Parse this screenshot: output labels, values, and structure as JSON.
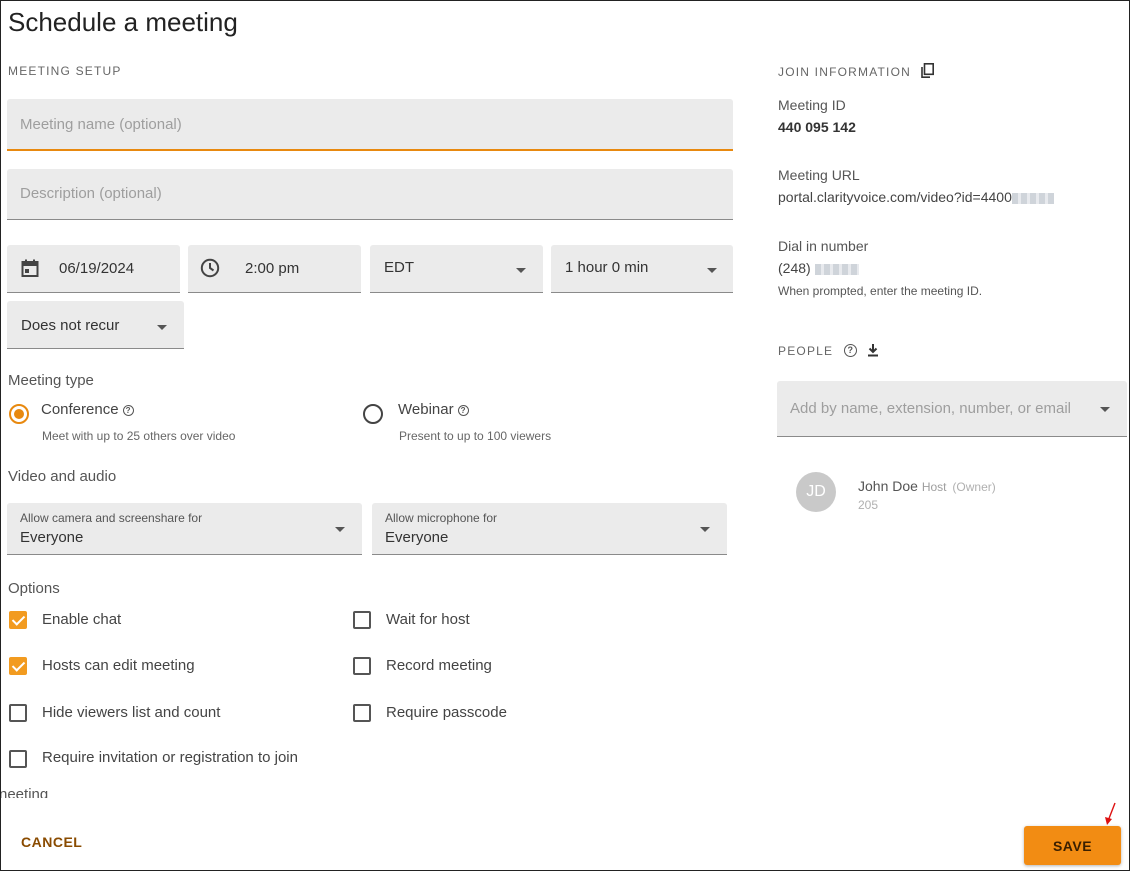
{
  "title": "Schedule a meeting",
  "setup": {
    "caption": "MEETING SETUP",
    "name_placeholder": "Meeting name (optional)",
    "description_placeholder": "Description (optional)",
    "date": "06/19/2024",
    "time": "2:00 pm",
    "timezone": "EDT",
    "duration": "1 hour 0 min",
    "recurrence": "Does not recur"
  },
  "meeting_type": {
    "label": "Meeting type",
    "conference": {
      "label": "Conference",
      "sub": "Meet with up to 25 others over video",
      "selected": true
    },
    "webinar": {
      "label": "Webinar",
      "sub": "Present to up to 100 viewers",
      "selected": false
    }
  },
  "video_audio": {
    "label": "Video and audio",
    "camera": {
      "label": "Allow camera and screenshare for",
      "value": "Everyone"
    },
    "mic": {
      "label": "Allow microphone for",
      "value": "Everyone"
    }
  },
  "options": {
    "label": "Options",
    "items": [
      {
        "label": "Enable chat",
        "checked": true
      },
      {
        "label": "Wait for host",
        "checked": false
      },
      {
        "label": "Hosts can edit meeting",
        "checked": true
      },
      {
        "label": "Record meeting",
        "checked": false
      },
      {
        "label": "Hide viewers list and count",
        "checked": false
      },
      {
        "label": "Require passcode",
        "checked": false
      },
      {
        "label": "Require invitation or registration to join",
        "checked": false
      }
    ],
    "cutoff_label": "neeting"
  },
  "join": {
    "caption": "JOIN INFORMATION",
    "meeting_id_label": "Meeting ID",
    "meeting_id": "440 095 142",
    "url_label": "Meeting URL",
    "url": "portal.clarityvoice.com/video?id=4400",
    "dial_label": "Dial in number",
    "dial_prefix": "(248)",
    "dial_note": "When prompted, enter the meeting ID."
  },
  "people": {
    "caption": "PEOPLE",
    "add_placeholder": "Add by name, extension, number, or email",
    "list": [
      {
        "initials": "JD",
        "name": "John Doe",
        "role": "Host",
        "owner": "(Owner)",
        "ext": "205"
      }
    ]
  },
  "actions": {
    "cancel": "CANCEL",
    "save": "SAVE"
  },
  "colors": {
    "accent": "#f28c13",
    "field_bg": "#ebebeb"
  }
}
